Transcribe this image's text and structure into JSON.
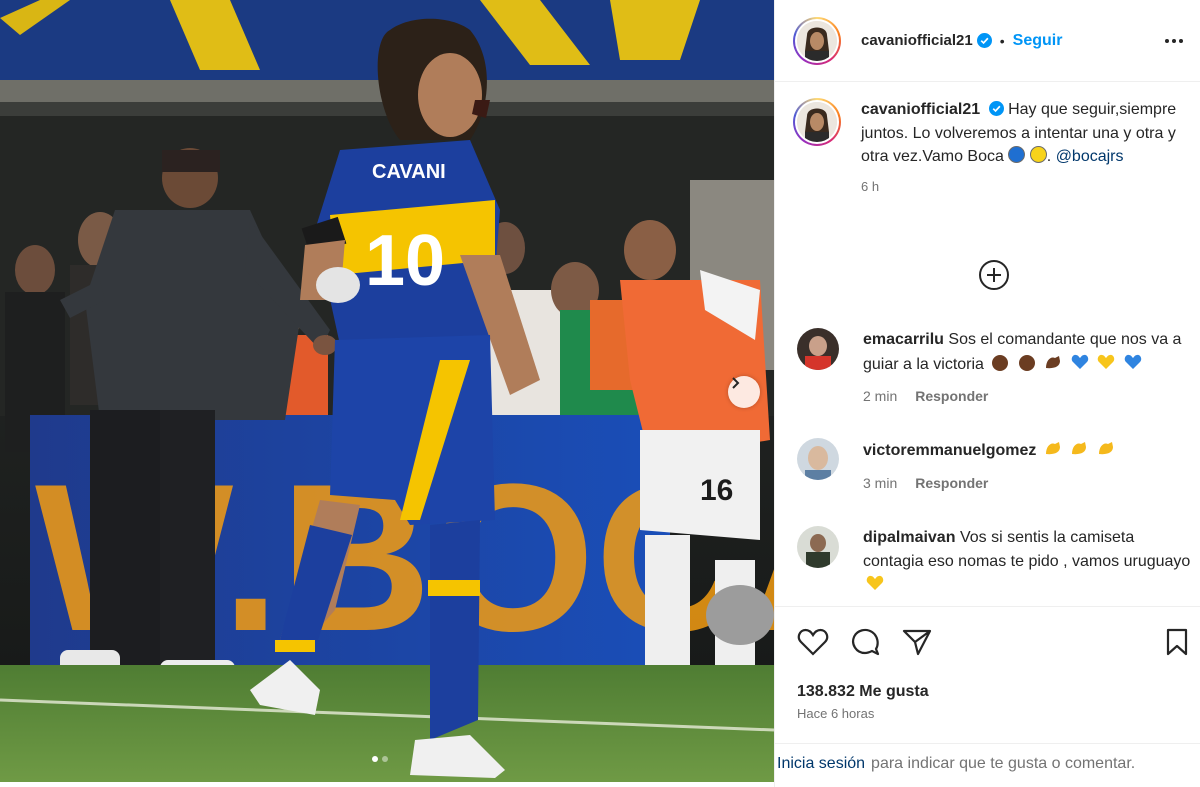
{
  "post": {
    "username": "cavaniofficial21",
    "follow_label": "Seguir",
    "separator": "•",
    "caption_text": "Hay que seguir,siempre juntos. Lo volveremos a intentar una y otra y otra vez.Vamo Boca",
    "caption_mention": "@bocajrs",
    "caption_time": "6 h",
    "likes": "138.832 Me gusta",
    "posted_ago": "Hace 6 horas"
  },
  "photo": {
    "jersey_name": "CAVANI",
    "jersey_number": "10",
    "board_text": "W.BOCA",
    "bench_number": "16"
  },
  "comments": [
    {
      "username": "emacarrilu",
      "text": "Sos el comandante que nos va a guiar a la victoria",
      "time": "2 min",
      "reply": "Responder"
    },
    {
      "username": "victoremmanuelgomez",
      "text": "",
      "time": "3 min",
      "reply": "Responder"
    },
    {
      "username": "dipalmaivan",
      "text": "Vos si sentis la camiseta contagia eso nomas te pido , vamos uruguayo",
      "time": "",
      "reply": ""
    }
  ],
  "footer": {
    "login_link": "Inicia sesión",
    "login_rest": "para indicar que te gusta o comentar."
  },
  "colors": {
    "accent_blue": "#0095f6",
    "boca_blue": "#1c3f9e",
    "boca_yellow": "#f5c400",
    "link_dark": "#00376b"
  },
  "icons": [
    "verified-badge-icon",
    "more-options-icon",
    "add-circle-icon",
    "chevron-right-icon",
    "heart-icon",
    "comment-icon",
    "share-icon",
    "bookmark-icon"
  ]
}
